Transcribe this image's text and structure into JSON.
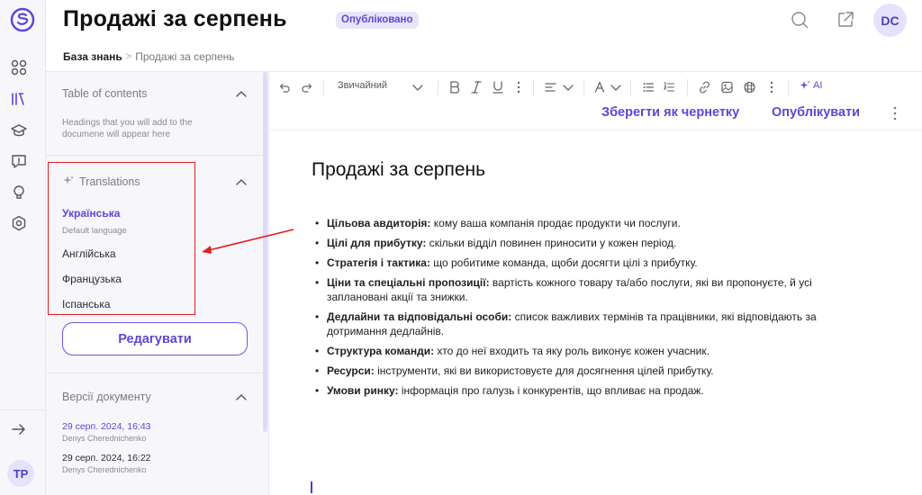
{
  "header": {
    "title": "Продажі за серпень",
    "status": "Опубліковано",
    "avatar_initials": "DC"
  },
  "breadcrumb": {
    "root": "База знань",
    "separator": ">",
    "current": "Продажі за серпень"
  },
  "rail": {
    "icons": [
      "apps-icon",
      "library-icon",
      "graduation-cap-icon",
      "question-chat-icon",
      "lightbulb-icon",
      "settings-hex-icon",
      "arrow-right-icon"
    ],
    "avatar_initials": "TP"
  },
  "toc": {
    "title": "Table of contents",
    "hint": "Headings that you will add to the documene will appear here"
  },
  "translations": {
    "title": "Translations",
    "default_language": "Українська",
    "default_label": "Default language",
    "languages": [
      "Англійська",
      "Французька",
      "Іспанська"
    ],
    "edit_button": "Редагувати"
  },
  "versions": {
    "title": "Версії документу",
    "items": [
      {
        "date": "29 серп. 2024, 16:43",
        "author": "Denys Cherednichenko"
      },
      {
        "date": "29 серп. 2024, 16:22",
        "author": "Denys Cherednichenko"
      }
    ]
  },
  "toolbar": {
    "text_style": "Звичайний",
    "ai_label": "AI"
  },
  "actions": {
    "save_draft": "Зберегти як чернетку",
    "publish": "Опублікувати"
  },
  "document": {
    "title": "Продажі за серпень",
    "items": [
      {
        "term": "Цільова авдиторія:",
        "text": " кому ваша компанія продає продукти чи послуги."
      },
      {
        "term": "Цілі для прибутку:",
        "text": " скільки відділ повинен приносити у кожен період."
      },
      {
        "term": "Стратегія і тактика:",
        "text": " що робитиме команда, щоби досягти цілі з прибутку."
      },
      {
        "term": "Ціни та спеціальні пропозиції:",
        "text": " вартість кожного товару та/або послуги, які ви пропонуєте, й усі заплановані акції та знижки."
      },
      {
        "term": "Дедлайни та відповідальні особи:",
        "text": " список важливих термінів та працівники, які відповідають за дотримання дедлайнів."
      },
      {
        "term": "Структура команди:",
        "text": " хто до неї входить та яку роль виконує кожен учасник."
      },
      {
        "term": "Ресурси:",
        "text": " інструменти, які ви використовуєте для досягнення цілей прибутку."
      },
      {
        "term": "Умови ринку:",
        "text": " інформація про галузь і конкурентів, що впливає на продаж."
      }
    ]
  },
  "colors": {
    "accent": "#5b47d6",
    "annotation_red": "#e02020",
    "panel_bg": "#f7f7fb"
  }
}
